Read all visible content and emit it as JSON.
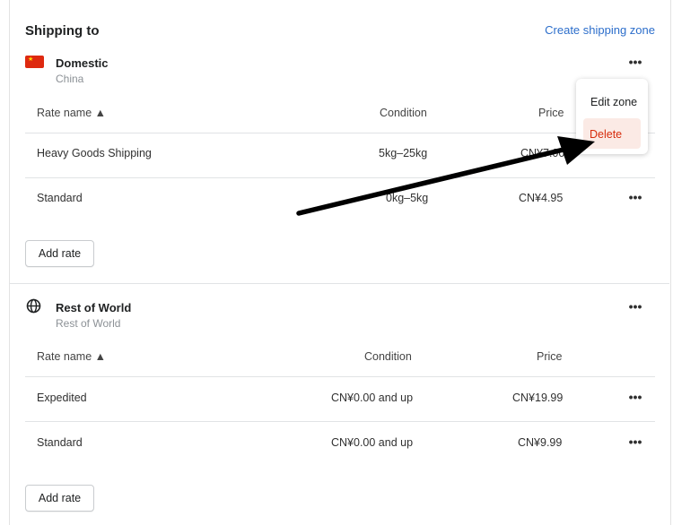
{
  "header": {
    "title": "Shipping to",
    "create_link": "Create shipping zone"
  },
  "zones": [
    {
      "name": "Domestic",
      "subtitle": "China",
      "icon": "china-flag-icon",
      "columns": [
        "Rate name ▲",
        "Condition",
        "Price"
      ],
      "rows": [
        {
          "name": "Heavy Goods Shipping",
          "condition": "5kg–25kg",
          "price": "CN¥7.00"
        },
        {
          "name": "Standard",
          "condition": "0kg–5kg",
          "price": "CN¥4.95"
        }
      ],
      "add_rate_label": "Add rate"
    },
    {
      "name": "Rest of World",
      "subtitle": "Rest of World",
      "icon": "globe-icon",
      "columns": [
        "Rate name ▲",
        "Condition",
        "Price"
      ],
      "rows": [
        {
          "name": "Expedited",
          "condition": "CN¥0.00 and up",
          "price": "CN¥19.99"
        },
        {
          "name": "Standard",
          "condition": "CN¥0.00 and up",
          "price": "CN¥9.99"
        }
      ],
      "add_rate_label": "Add rate"
    }
  ],
  "context_menu": {
    "items": [
      {
        "label": "Edit zone"
      },
      {
        "label": "Delete"
      }
    ]
  },
  "colors": {
    "link": "#2c6ecb",
    "danger": "#d72c0d",
    "danger_bg": "#fbeae5",
    "flag_red": "#de2910",
    "flag_star": "#ffde00"
  }
}
